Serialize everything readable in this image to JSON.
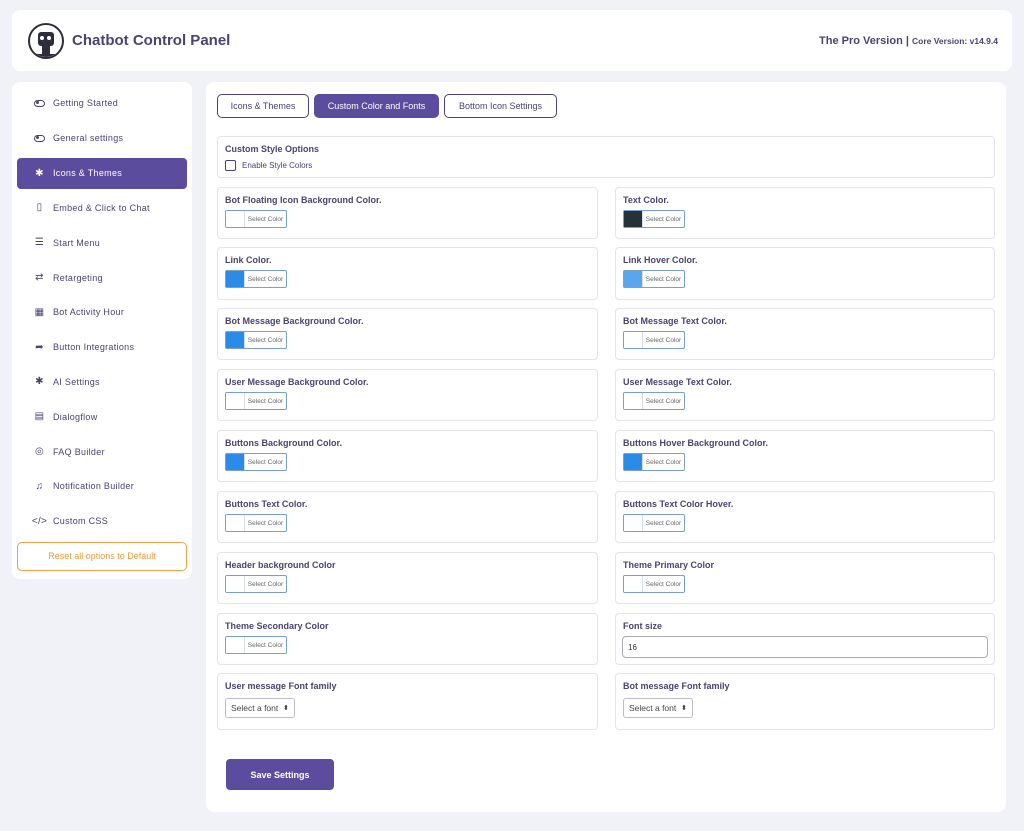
{
  "header": {
    "title": "Chatbot Control Panel",
    "pro_version": "The Pro Version",
    "separator": " | ",
    "core_version": "Core Version: v14.9.4"
  },
  "sidebar": {
    "items": [
      {
        "label": "Getting Started",
        "icon": "toggle-icon"
      },
      {
        "label": "General settings",
        "icon": "toggle-icon"
      },
      {
        "label": "Icons & Themes",
        "icon": "gear-icon",
        "active": true
      },
      {
        "label": "Embed & Click to Chat",
        "icon": "mobile-icon"
      },
      {
        "label": "Start Menu",
        "icon": "menu-icon"
      },
      {
        "label": "Retargeting",
        "icon": "retweet-icon"
      },
      {
        "label": "Bot Activity Hour",
        "icon": "calendar-icon"
      },
      {
        "label": "Button Integrations",
        "icon": "share-icon"
      },
      {
        "label": "AI Settings",
        "icon": "gear-icon"
      },
      {
        "label": "Dialogflow",
        "icon": "dialogflow-icon"
      },
      {
        "label": "FAQ Builder",
        "icon": "lifebuoy-icon"
      },
      {
        "label": "Notification Builder",
        "icon": "bell-icon"
      },
      {
        "label": "Custom CSS",
        "icon": "code-icon"
      }
    ],
    "reset_label": "Reset all options to Default"
  },
  "tabs": [
    {
      "label": "Icons & Themes",
      "active": false
    },
    {
      "label": "Custom Color and Fonts",
      "active": true
    },
    {
      "label": "Bottom Icon Settings",
      "active": false
    }
  ],
  "custom_style": {
    "title": "Custom Style Options",
    "enable_label": "Enable Style Colors",
    "enabled": false
  },
  "color_button_label": "Select Color",
  "colors": {
    "bot_floating_icon_bg": {
      "label": "Bot Floating Icon Background Color.",
      "value": "#ffffff"
    },
    "text_color": {
      "label": "Text Color.",
      "value": "#263238"
    },
    "link_color": {
      "label": "Link Color.",
      "value": "#2a8ce6"
    },
    "link_hover_color": {
      "label": "Link Hover Color.",
      "value": "#5aa6ec"
    },
    "bot_message_bg": {
      "label": "Bot Message Background Color.",
      "value": "#2a8ce6"
    },
    "bot_message_text": {
      "label": "Bot Message Text Color.",
      "value": "#ffffff"
    },
    "user_message_bg": {
      "label": "User Message Background Color.",
      "value": "#ffffff"
    },
    "user_message_text": {
      "label": "User Message Text Color.",
      "value": "#ffffff"
    },
    "buttons_bg": {
      "label": "Buttons Background Color.",
      "value": "#2a8ce6"
    },
    "buttons_hover_bg": {
      "label": "Buttons Hover Background Color.",
      "value": "#2a8ce6"
    },
    "buttons_text": {
      "label": "Buttons Text Color.",
      "value": "#ffffff"
    },
    "buttons_text_hover": {
      "label": "Buttons Text Color Hover.",
      "value": "#ffffff"
    },
    "header_bg": {
      "label": "Header background Color",
      "value": "#ffffff"
    },
    "theme_primary": {
      "label": "Theme Primary Color",
      "value": "#ffffff"
    },
    "theme_secondary": {
      "label": "Theme Secondary Color",
      "value": "#ffffff"
    }
  },
  "font_size": {
    "label": "Font size",
    "value": "16"
  },
  "user_font_family": {
    "label": "User message Font family",
    "value": "Select a font"
  },
  "bot_font_family": {
    "label": "Bot message Font family",
    "value": "Select a font"
  },
  "save_label": "Save Settings"
}
